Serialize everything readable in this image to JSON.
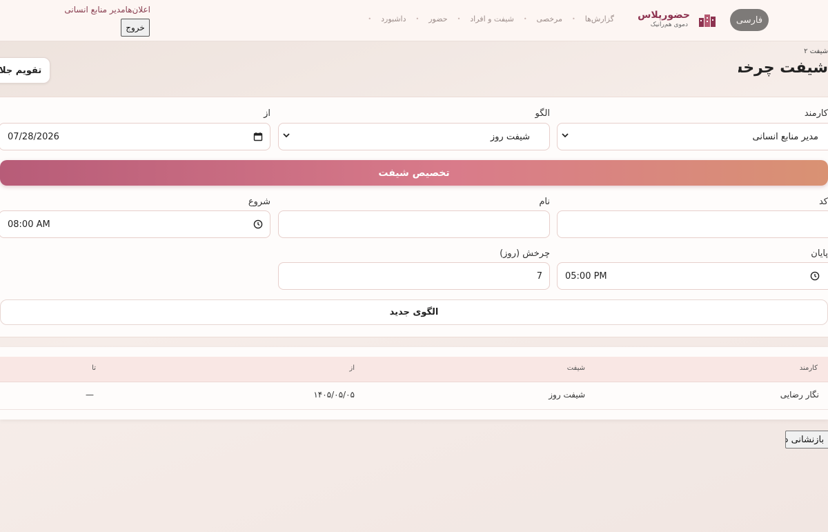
{
  "header": {
    "language": "فارسی",
    "brand_name": "حضورپلاس",
    "brand_subtitle": "دموی هم‌رانیک",
    "nav": [
      "داشبورد",
      "حضور",
      "شیفت و افراد",
      "مرخصی",
      "گزارش‌ها"
    ],
    "user_line": "اعلان‌هامدیر منابع انسانی",
    "logout": "خروج"
  },
  "page": {
    "breadcrumb": "شیفت ۲",
    "title": "شیفت چرخشی",
    "calendar_toggle": "تقویم جلالی"
  },
  "assign_form": {
    "employee_label": "کارمند",
    "employee_value": "مدیر منابع انسانی",
    "pattern_label": "الگو",
    "pattern_value": "شیفت روز",
    "from_label": "از",
    "from_value": "07/28/2026",
    "submit": "تخصیص شیفت"
  },
  "pattern_form": {
    "code_label": "کد",
    "code_value": "",
    "name_label": "نام",
    "name_value": "",
    "start_label": "شروع",
    "start_value": "08:00 AM",
    "end_label": "پایان",
    "end_value": "05:00 PM",
    "cycle_label": "چرخش (روز)",
    "cycle_value": "7",
    "submit": "الگوی جدید"
  },
  "table": {
    "columns": [
      "کارمند",
      "شیفت",
      "از",
      "تا"
    ],
    "rows": [
      [
        "نگار رضایی",
        "شیفت روز",
        "۱۴۰۵/۰۵/۰۵",
        "—"
      ]
    ]
  },
  "demo_reset": "بازنشانی دمو"
}
